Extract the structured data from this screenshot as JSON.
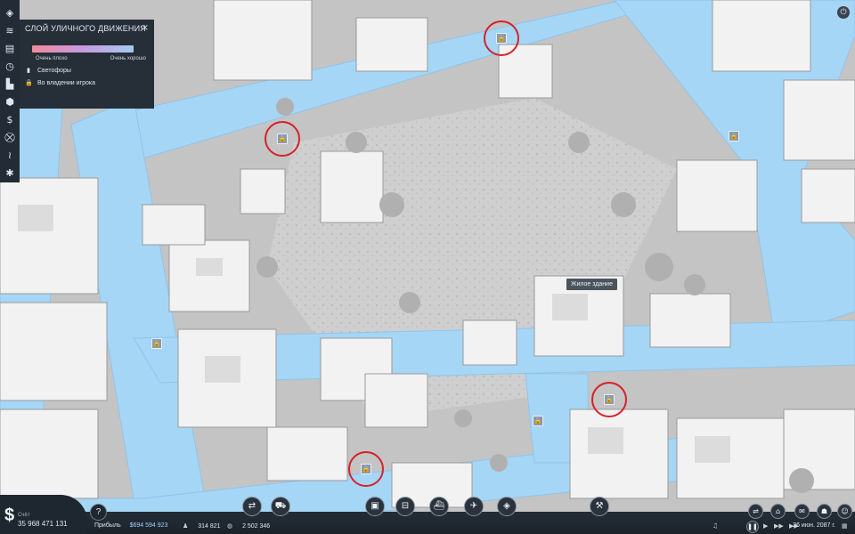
{
  "layer_panel": {
    "title": "СЛОЙ УЛИЧНОГО ДВИЖЕНИЯ",
    "close": "×",
    "legend_low": "Очень плохо",
    "legend_high": "Очень хорошо",
    "items": [
      {
        "label": "Светофоры",
        "icon": "traffic-light-icon"
      },
      {
        "label": "Во владении игрока",
        "icon": "lock-icon"
      }
    ]
  },
  "tooltip": {
    "text": "Жилое здание"
  },
  "left_toolbar": {
    "icons": [
      "layers-icon",
      "stack-icon",
      "book-icon",
      "compass-icon",
      "city-icon",
      "cube-icon",
      "money-icon",
      "traffic-icon",
      "sound-icon",
      "settings-icon"
    ]
  },
  "lock_markers": {
    "glyph": "🔒",
    "count": 5
  },
  "money": {
    "symbol": "$",
    "label": "Счёт",
    "value": "35 968 471 131"
  },
  "stats": {
    "profit_label": "Прибыль",
    "profit_value": "$694 594 923",
    "population": "314 821",
    "residents": "2 502 346"
  },
  "date": "26 июн. 2087 г.",
  "colors": {
    "road_traffic_good": "#a6d6f5",
    "road_traffic_bad": "#f08a9a",
    "marker_circle": "#d4222a",
    "ui_dark": "#1e262f"
  },
  "bottom_tools": [
    "transfer-icon",
    "bus-stop-icon",
    "bus-icon",
    "tram-icon",
    "ship-icon",
    "plane-icon",
    "cargo-icon",
    "bulldozer-icon"
  ],
  "right_tools": [
    "route-icon",
    "depot-icon",
    "chat-icon",
    "group-icon",
    "people-icon"
  ],
  "speed_controls": [
    "pause-icon",
    "play-icon",
    "fast-icon",
    "fastest-icon"
  ]
}
